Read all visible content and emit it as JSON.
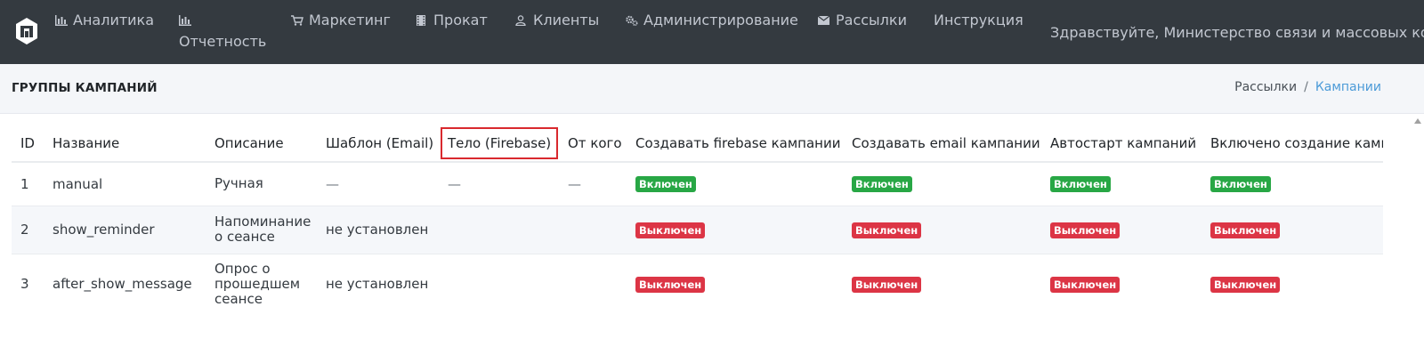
{
  "nav": {
    "items": [
      {
        "label": "Аналитика",
        "icon": "bar-chart-icon"
      },
      {
        "label": "Отчетность",
        "icon": "bar-chart-icon"
      },
      {
        "label": "Маркетинг",
        "icon": "cart-icon"
      },
      {
        "label": "Прокат",
        "icon": "film-icon"
      },
      {
        "label": "Клиенты",
        "icon": "user-icon"
      },
      {
        "label": "Администрирование",
        "icon": "gears-icon"
      },
      {
        "label": "Рассылки",
        "icon": "envelope-icon"
      },
      {
        "label": "Инструкция",
        "icon": ""
      }
    ],
    "greeting": "Здравствуйте, Министерство связи и массовых ком"
  },
  "header": {
    "title": "ГРУППЫ КАМПАНИЙ",
    "breadcrumb": [
      "Рассылки",
      "Кампании"
    ]
  },
  "table": {
    "columns": [
      "ID",
      "Название",
      "Описание",
      "Шаблон (Email)",
      "Тело (Firebase)",
      "От кого",
      "Создавать firebase кампании",
      "Создавать email кампании",
      "Автостарт кампаний",
      "Включено создание кампаний"
    ],
    "rows": [
      {
        "id": "1",
        "name": "manual",
        "description": [
          "Ручная"
        ],
        "template_email": "—",
        "body_firebase": "—",
        "from": "—",
        "firebase": "Включен",
        "email": "Включен",
        "autostart": "Включен",
        "creation_enabled": "Включен"
      },
      {
        "id": "2",
        "name": "show_reminder",
        "description": [
          "Напоминание",
          "о сеансе"
        ],
        "template_email": "не установлен",
        "body_firebase": "",
        "from": "",
        "firebase": "Выключен",
        "email": "Выключен",
        "autostart": "Выключен",
        "creation_enabled": "Выключен"
      },
      {
        "id": "3",
        "name": "after_show_message",
        "description": [
          "Опрос о",
          "прошедшем",
          "сеансе"
        ],
        "template_email": "не установлен",
        "body_firebase": "",
        "from": "",
        "firebase": "Выключен",
        "email": "Выключен",
        "autostart": "Выключен",
        "creation_enabled": "Выключен"
      }
    ]
  },
  "colors": {
    "navbar_bg": "#343a40",
    "header_bg": "#f4f6f9",
    "badge_on": "#28a745",
    "badge_off": "#dc3545",
    "highlight_border": "#d9292e",
    "breadcrumb_active": "#4c9bd8"
  }
}
